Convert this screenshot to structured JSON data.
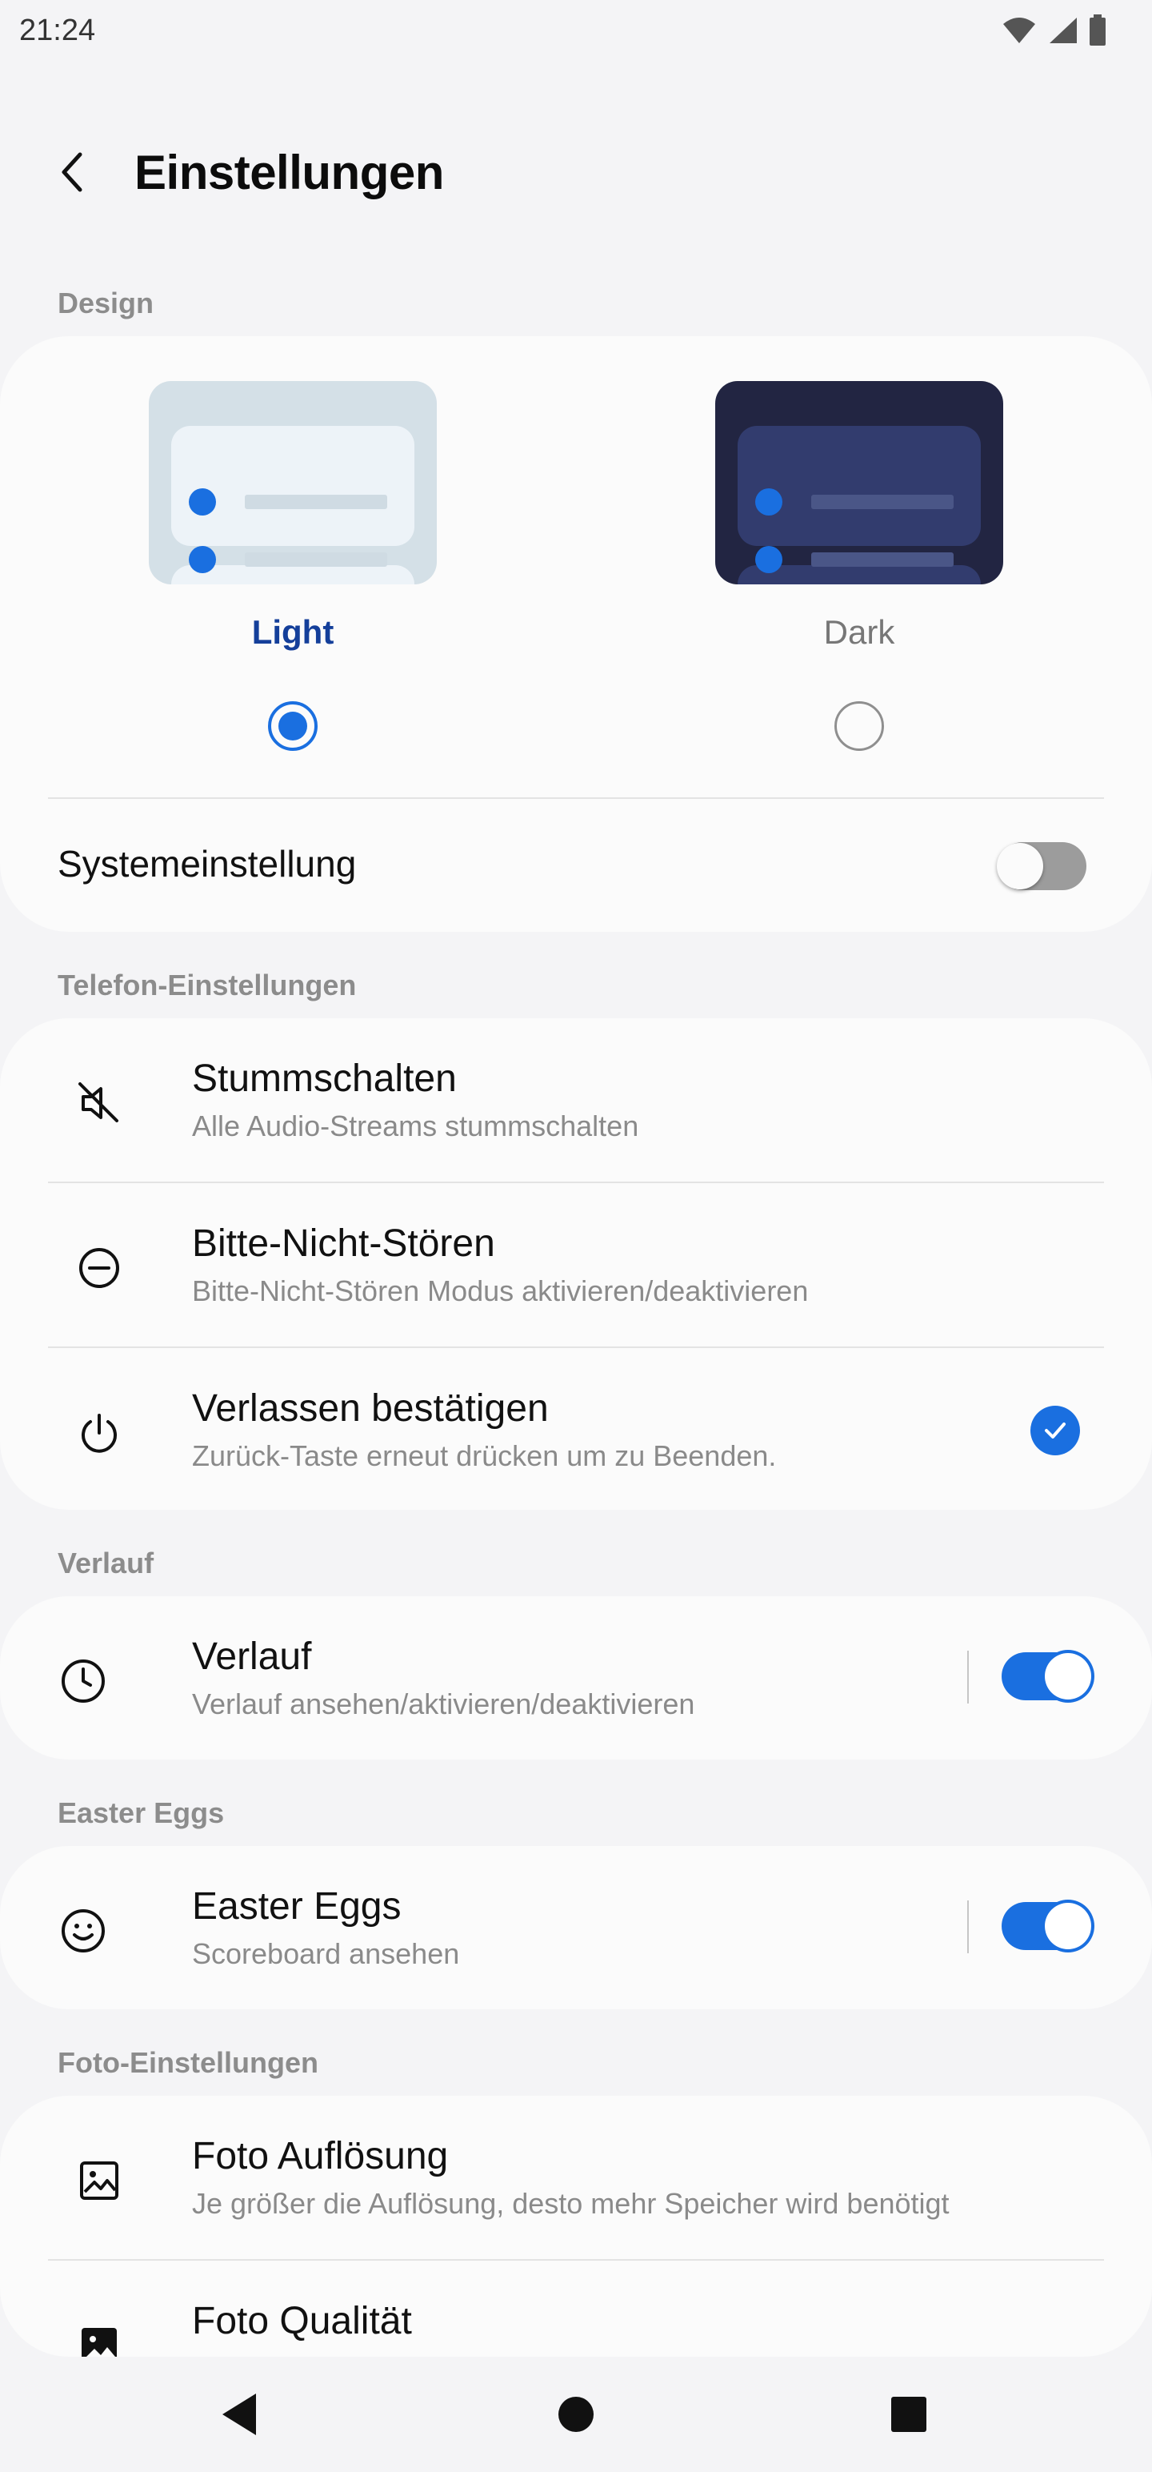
{
  "status_bar": {
    "time": "21:24",
    "icons": [
      "wifi-icon",
      "cell-signal-icon",
      "battery-icon"
    ]
  },
  "header": {
    "back_icon": "chevron-left-icon",
    "title": "Einstellungen"
  },
  "design": {
    "section_label": "Design",
    "options": [
      {
        "label": "Light",
        "selected": true
      },
      {
        "label": "Dark",
        "selected": false
      }
    ],
    "system_setting": {
      "label": "Systemeinstellung",
      "enabled": false
    }
  },
  "phone_settings": {
    "section_label": "Telefon-Einstellungen",
    "items": [
      {
        "icon": "mute-icon",
        "title": "Stummschalten",
        "subtitle": "Alle Audio-Streams stummschalten"
      },
      {
        "icon": "do-not-disturb-icon",
        "title": "Bitte-Nicht-Stören",
        "subtitle": "Bitte-Nicht-Stören Modus aktivieren/deaktivieren"
      },
      {
        "icon": "power-icon",
        "title": "Verlassen bestätigen",
        "subtitle": "Zurück-Taste erneut drücken um zu Beenden.",
        "checked": true
      }
    ]
  },
  "history": {
    "section_label": "Verlauf",
    "item": {
      "icon": "clock-icon",
      "title": "Verlauf",
      "subtitle": "Verlauf ansehen/aktivieren/deaktivieren",
      "enabled": true
    }
  },
  "easter_eggs": {
    "section_label": "Easter Eggs",
    "item": {
      "icon": "smiley-icon",
      "title": "Easter Eggs",
      "subtitle": "Scoreboard ansehen",
      "enabled": true
    }
  },
  "photo_settings": {
    "section_label": "Foto-Einstellungen",
    "items": [
      {
        "icon": "image-outline-icon",
        "title": "Foto Auflösung",
        "subtitle": "Je größer die Auflösung, desto mehr Speicher wird benötigt"
      },
      {
        "icon": "image-filled-icon",
        "title": "Foto Qualität"
      }
    ]
  },
  "nav_bar": {
    "icons": [
      "nav-back-icon",
      "nav-home-icon",
      "nav-recents-icon"
    ]
  },
  "colors": {
    "accent": "#1a6fe0",
    "selected_label": "#143f9a",
    "background": "#f4f4f6",
    "card": "#fbfbfb",
    "muted_text": "#8a8a8a"
  }
}
